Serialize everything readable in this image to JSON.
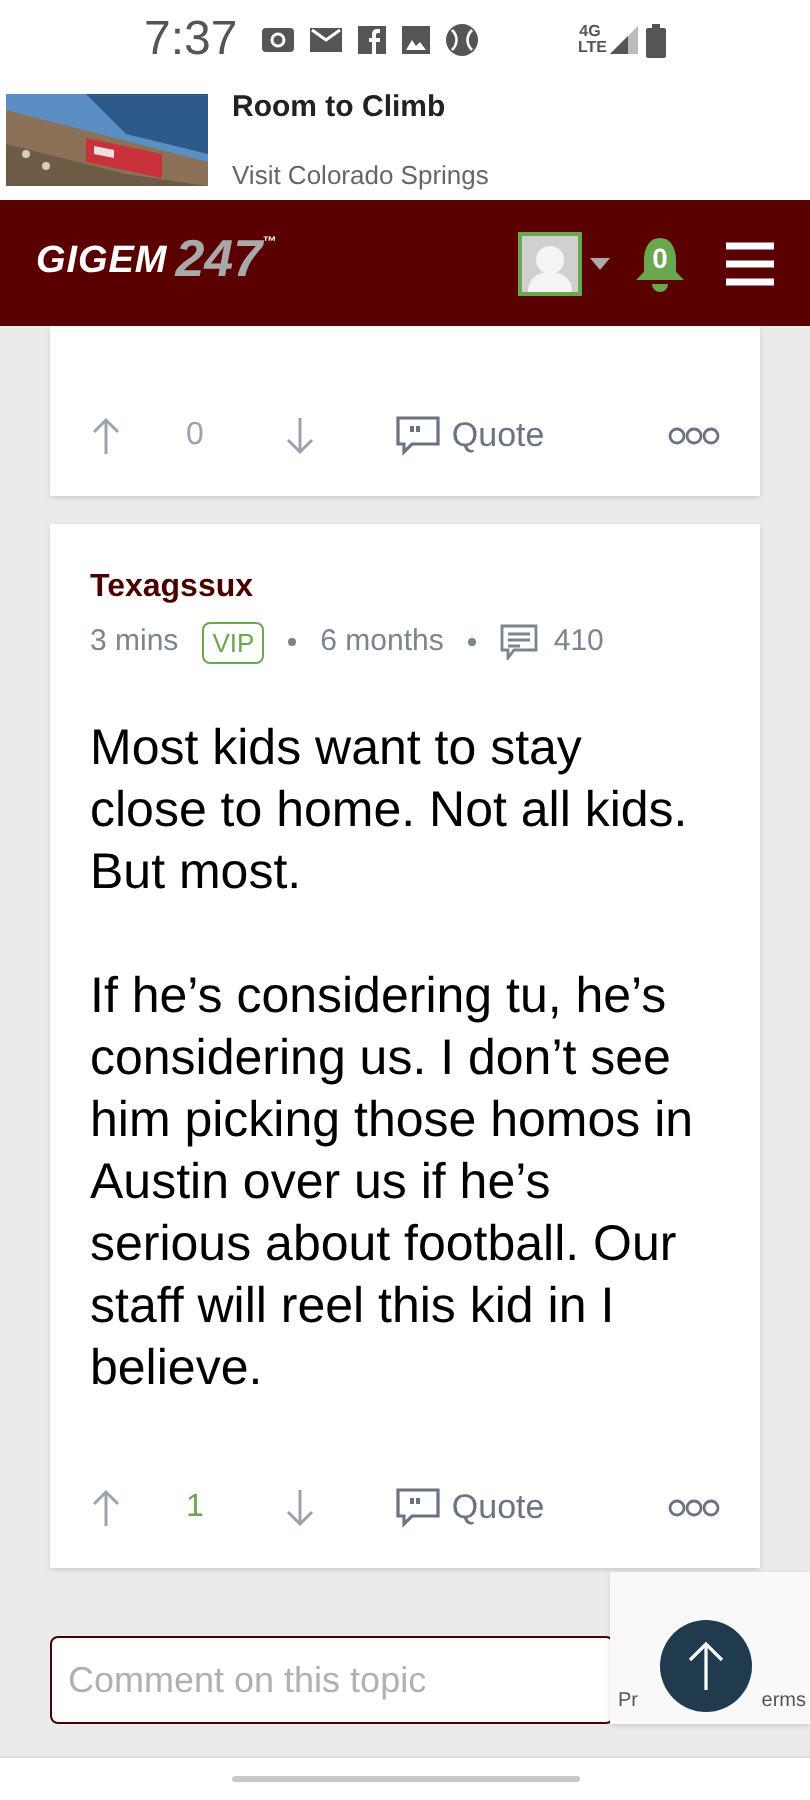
{
  "status_bar": {
    "time": "7:37",
    "network": "4G LTE"
  },
  "ad": {
    "title": "Room to Climb",
    "sponsor": "Visit Colorado Springs"
  },
  "header": {
    "logo_word": "GIGEM",
    "logo_number": "247",
    "logo_mark": "™",
    "notification_count": "0"
  },
  "posts": [
    {
      "vote_count": "0",
      "voted": false,
      "quote_label": "Quote"
    },
    {
      "author": "Texagssux",
      "time": "3 mins",
      "badge": "VIP",
      "member_for": "6 months",
      "post_count": "410",
      "paragraphs": [
        "Most kids want to stay close to home. Not all kids. But most.",
        "If he’s considering tu, he’s considering us. I don’t see him picking those homos in Austin over us if he’s serious about football. Our staff will reel this kid in I believe."
      ],
      "vote_count": "1",
      "voted": true,
      "quote_label": "Quote"
    }
  ],
  "comment": {
    "placeholder": "Comment on this topic"
  },
  "recaptcha": {
    "text_left": "Pr",
    "text_right": "erms"
  }
}
